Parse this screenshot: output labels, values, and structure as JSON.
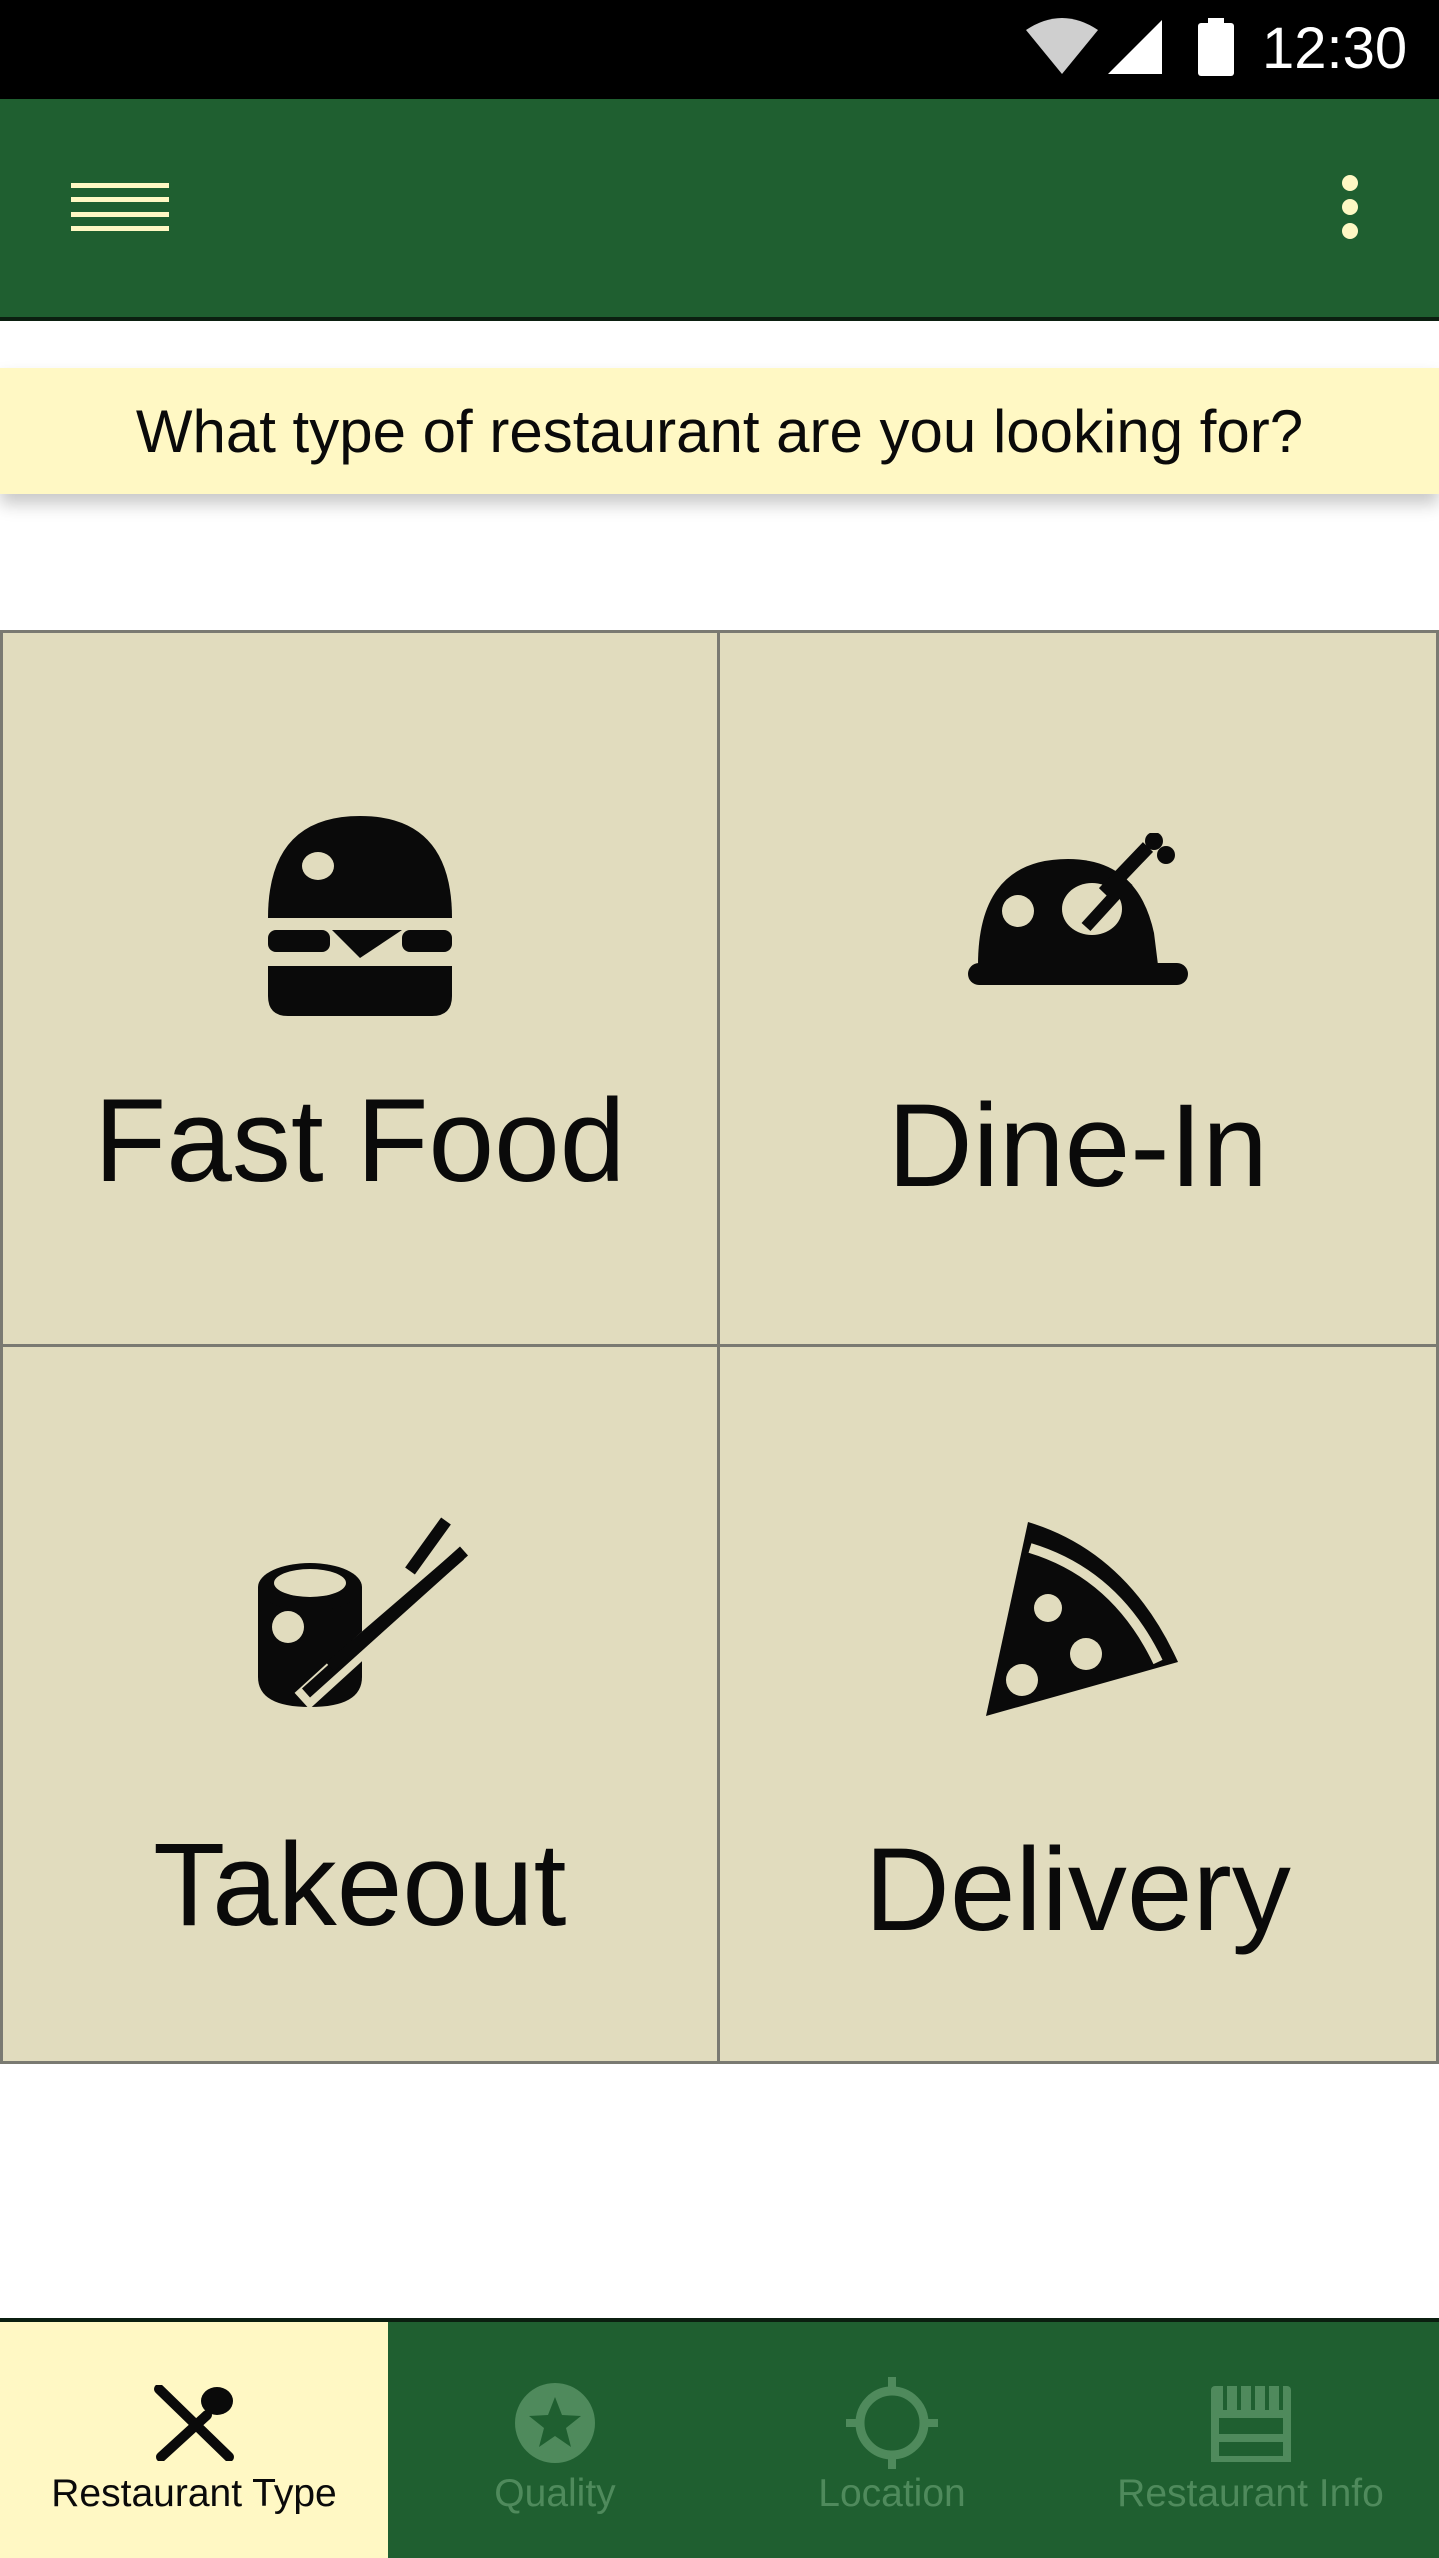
{
  "status_bar": {
    "time": "12:30",
    "icons": [
      "wifi-icon",
      "signal-icon",
      "battery-icon"
    ]
  },
  "app_bar": {
    "menu_icon": "hamburger-menu-icon",
    "overflow_icon": "more-vert-icon",
    "color": "#1f5f30"
  },
  "prompt": {
    "text": "What type of restaurant are you looking for?",
    "background": "#fff8c4"
  },
  "restaurant_types": [
    {
      "label": "Fast Food",
      "icon": "burger-icon"
    },
    {
      "label": "Dine-In",
      "icon": "roast-chicken-icon"
    },
    {
      "label": "Takeout",
      "icon": "sushi-chopsticks-icon"
    },
    {
      "label": "Delivery",
      "icon": "pizza-slice-icon"
    }
  ],
  "bottom_nav": {
    "items": [
      {
        "label": "Restaurant Type",
        "icon": "fork-spoon-icon",
        "active": true
      },
      {
        "label": "Quality",
        "icon": "star-badge-icon",
        "active": false
      },
      {
        "label": "Location",
        "icon": "location-target-icon",
        "active": false
      },
      {
        "label": "Restaurant Info",
        "icon": "storefront-icon",
        "active": false
      }
    ]
  },
  "colors": {
    "primary": "#1f5f30",
    "accent": "#fff8c4",
    "tile": "#e1dcbe",
    "inactive_nav": "#4f8a5c"
  }
}
